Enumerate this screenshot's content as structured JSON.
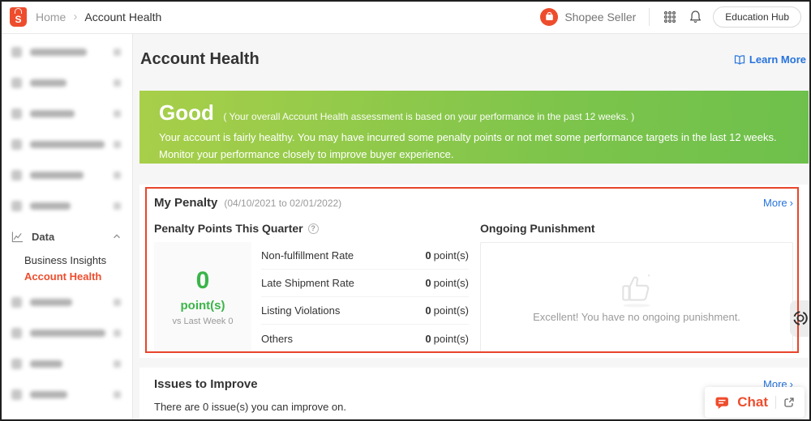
{
  "header": {
    "brand_initial": "S",
    "breadcrumb": {
      "home": "Home",
      "separator": "›",
      "current": "Account Health"
    },
    "seller_label": "Shopee Seller",
    "education_hub_label": "Education Hub"
  },
  "sidebar": {
    "blurred_item_count_top": 6,
    "blurred_item_count_bottom": 4,
    "data_section": {
      "label": "Data",
      "items": [
        {
          "label": "Business Insights",
          "active": false
        },
        {
          "label": "Account Health",
          "active": true
        }
      ]
    }
  },
  "page": {
    "title": "Account Health",
    "learn_more_label": "Learn More"
  },
  "banner": {
    "status": "Good",
    "note": "( Your overall Account Health assessment is based on your performance in the past 12 weeks. )",
    "description": "Your account is fairly healthy. You may have incurred some penalty points or not met some performance targets in the last 12 weeks. Monitor your performance closely to improve buyer experience."
  },
  "penalty": {
    "title": "My Penalty",
    "period": "(04/10/2021 to 02/01/2022)",
    "more_label": "More",
    "more_arrow": "›",
    "points": {
      "title": "Penalty Points This Quarter",
      "help_glyph": "?",
      "value": "0",
      "unit": "point(s)",
      "compare": "vs Last Week 0"
    },
    "rows": [
      {
        "label": "Non-fulfillment Rate",
        "value": "0",
        "unit": "point(s)"
      },
      {
        "label": "Late Shipment Rate",
        "value": "0",
        "unit": "point(s)"
      },
      {
        "label": "Listing Violations",
        "value": "0",
        "unit": "point(s)"
      },
      {
        "label": "Others",
        "value": "0",
        "unit": "point(s)"
      }
    ],
    "punishment": {
      "title": "Ongoing Punishment",
      "empty_text": "Excellent! You have no ongoing punishment."
    }
  },
  "issues": {
    "title": "Issues to Improve",
    "more_label": "More",
    "more_arrow": "›",
    "text": "There are 0 issue(s) you can improve on."
  },
  "chat": {
    "label": "Chat"
  },
  "icons": {
    "apps": "3x3-dot-grid",
    "notifications": "bell",
    "learn_more": "open-book",
    "points_help": "question-circle",
    "punishment_empty": "thumbs-up",
    "data_menu": "line-chart",
    "data_collapse": "chevron-up",
    "chat": "speech-bubble",
    "chat_expand": "open-in-new-window",
    "side_widget": "circle-target"
  },
  "colors": {
    "brand_orange": "#EE4D2D",
    "link_blue": "#2673DD",
    "banner_gradient_start": "#A8CF4A",
    "banner_gradient_end": "#6EC04C",
    "value_green": "#3BB54A",
    "annotation_red": "#E8452B"
  }
}
